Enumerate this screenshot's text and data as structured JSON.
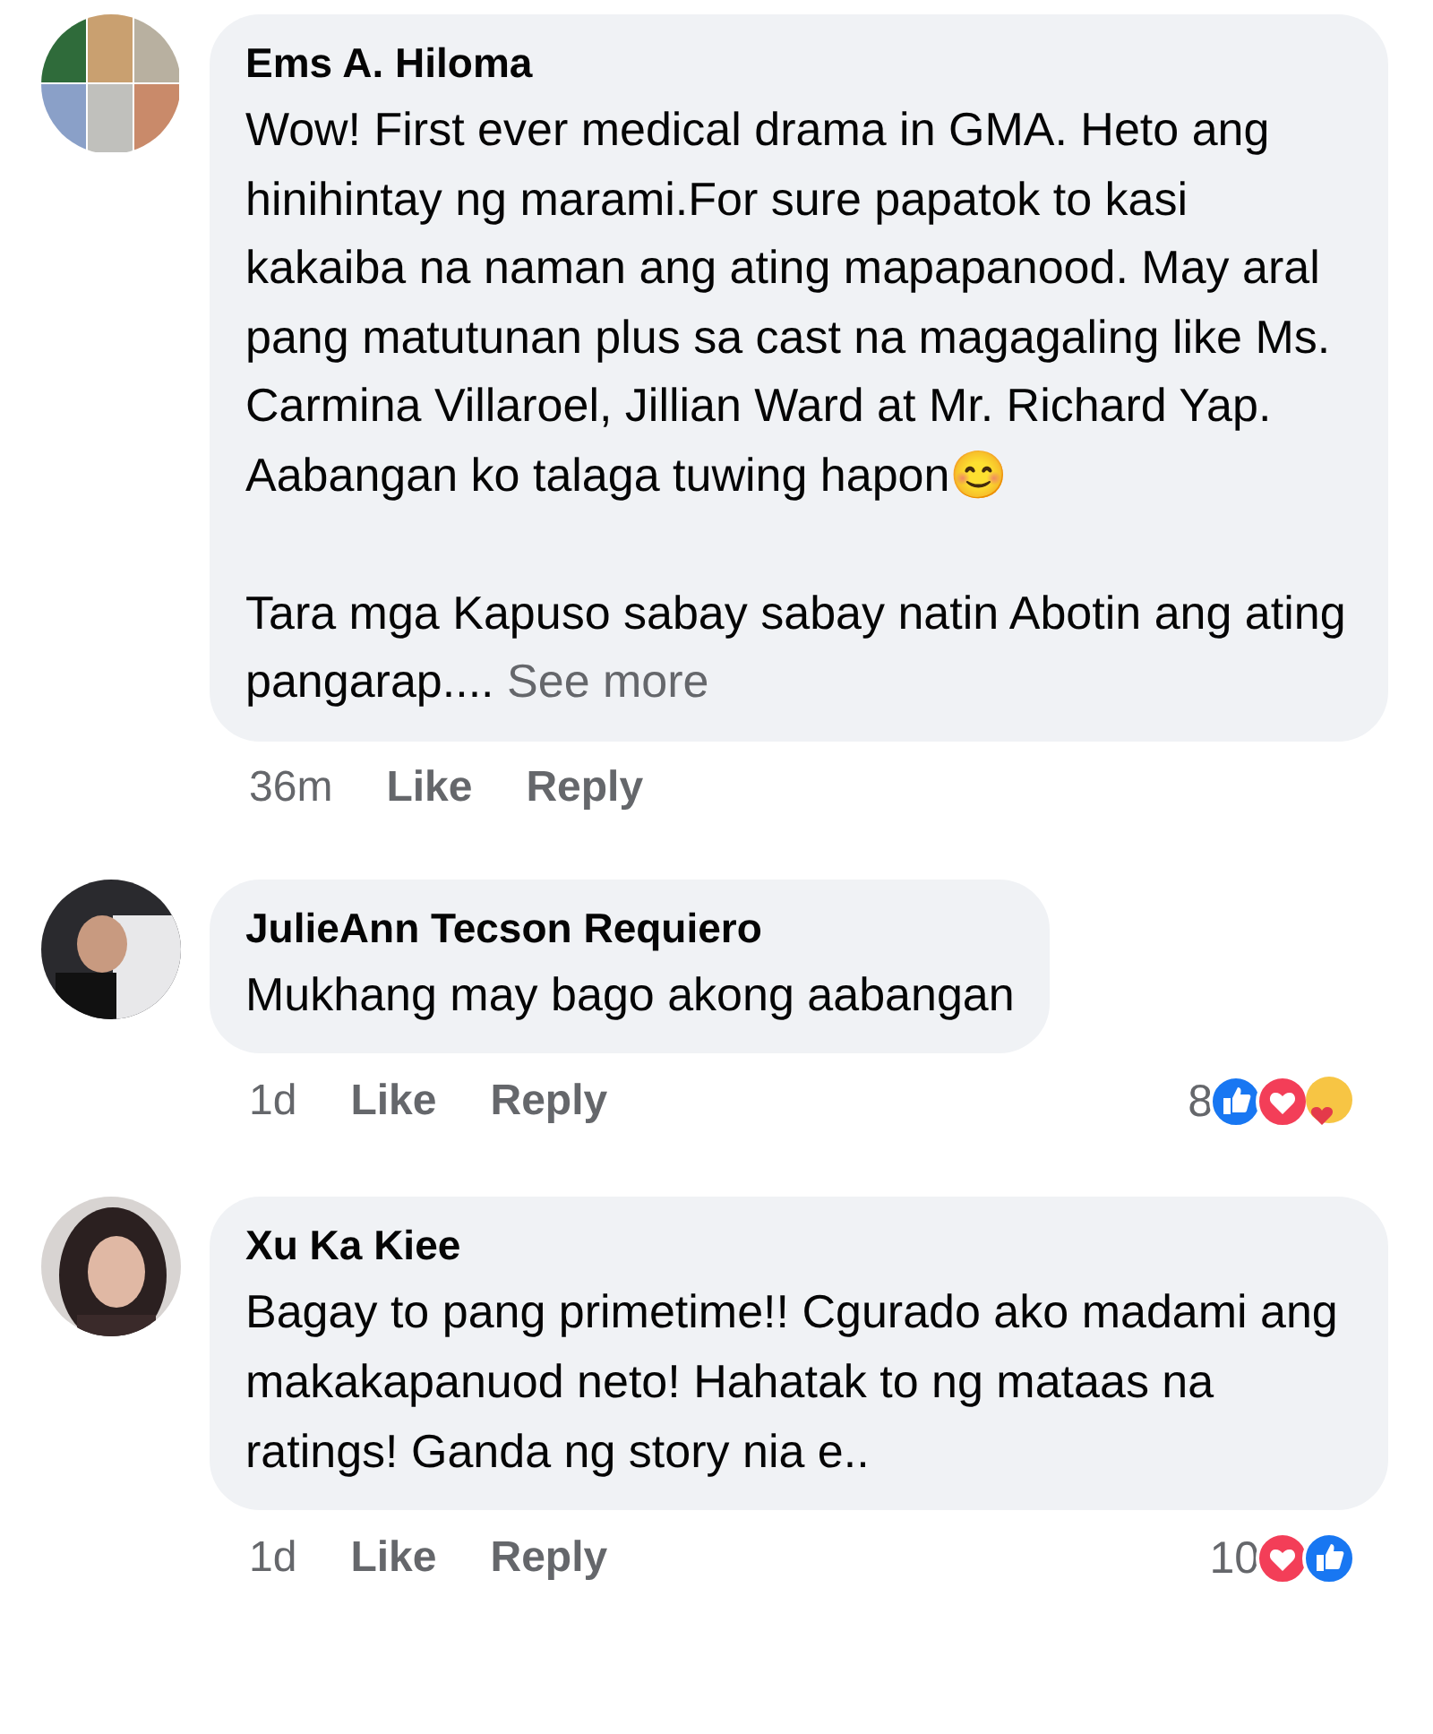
{
  "comments": [
    {
      "author": "Ems A. Hiloma",
      "paragraphs": [
        "Wow! First ever medical drama in GMA. Heto ang hinihintay ng marami.For sure papatok to kasi kakaiba na naman ang ating mapapanood. May aral pang matutunan plus sa cast na magagaling like Ms. Carmina Villaroel, Jillian Ward at Mr. Richard Yap. Aabangan ko talaga tuwing hapon😊",
        "Tara mga Kapuso sabay sabay natin Abotin ang ating pangarap...."
      ],
      "see_more": "See more",
      "time": "36m",
      "actions": [
        "Like",
        "Reply"
      ]
    },
    {
      "author": "JulieAnn Tecson Requiero",
      "paragraphs": [
        "Mukhang may bago akong aabangan"
      ],
      "time": "1d",
      "actions": [
        "Like",
        "Reply"
      ],
      "reactions": {
        "count": "8",
        "types": [
          {
            "kind": "like"
          },
          {
            "kind": "love"
          },
          {
            "kind": "care"
          }
        ]
      }
    },
    {
      "author": "Xu Ka Kiee",
      "paragraphs": [
        "Bagay to pang primetime!! Cgurado ako madami ang makakapanuod neto! Hahatak to ng mataas na ratings! Ganda ng story nia e.."
      ],
      "time": "1d",
      "actions": [
        "Like",
        "Reply"
      ],
      "reactions": {
        "count": "10",
        "types": [
          {
            "kind": "love"
          },
          {
            "kind": "like"
          }
        ]
      }
    }
  ]
}
